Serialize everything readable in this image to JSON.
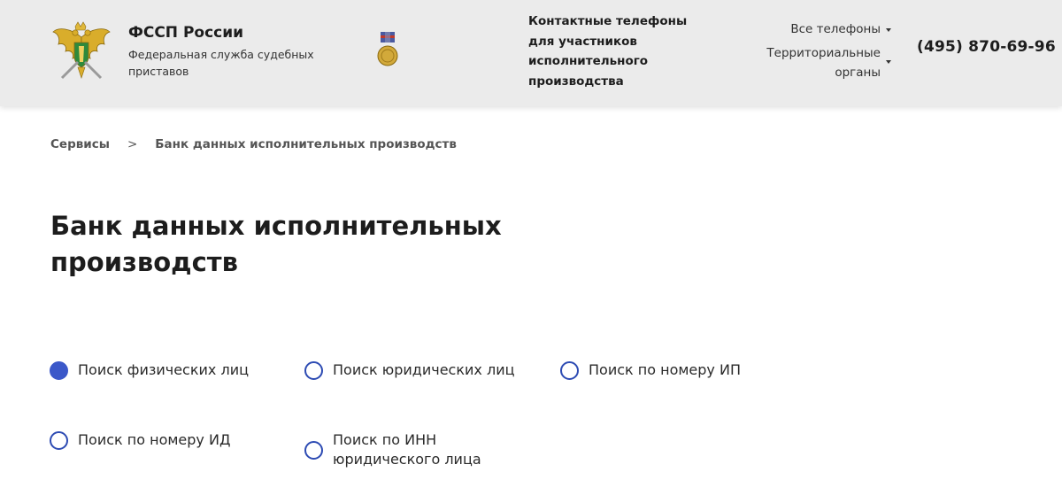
{
  "header": {
    "org_title": "ФССП России",
    "org_subtitle": "Федеральная служба судебных приставов",
    "logo_icon": "double-headed-eagle-emblem-icon",
    "medal_icon": "medal-award-icon",
    "contacts_note": "Контактные телефоны для участников исполнительного производства",
    "nav": {
      "all_phones": "Все телефоны",
      "territorial": "Территориальные органы"
    },
    "phone": "(495) 870-69-96"
  },
  "breadcrumb": {
    "items": [
      "Сервисы",
      "Банк данных исполнительных производств"
    ],
    "separator": ">"
  },
  "page_title": "Банк данных исполнительных производств",
  "search_options": [
    {
      "label": "Поиск физических лиц",
      "checked": true
    },
    {
      "label": "Поиск юридических лиц",
      "checked": false
    },
    {
      "label": "Поиск по номеру ИП",
      "checked": false
    },
    {
      "label": "Поиск по номеру ИД",
      "checked": false
    },
    {
      "label": "Поиск по ИНН юридического лица",
      "checked": false
    }
  ],
  "colors": {
    "accent": "#3b58c9",
    "header_bg": "#ebebeb",
    "emblem_gold": "#d4a82a"
  }
}
